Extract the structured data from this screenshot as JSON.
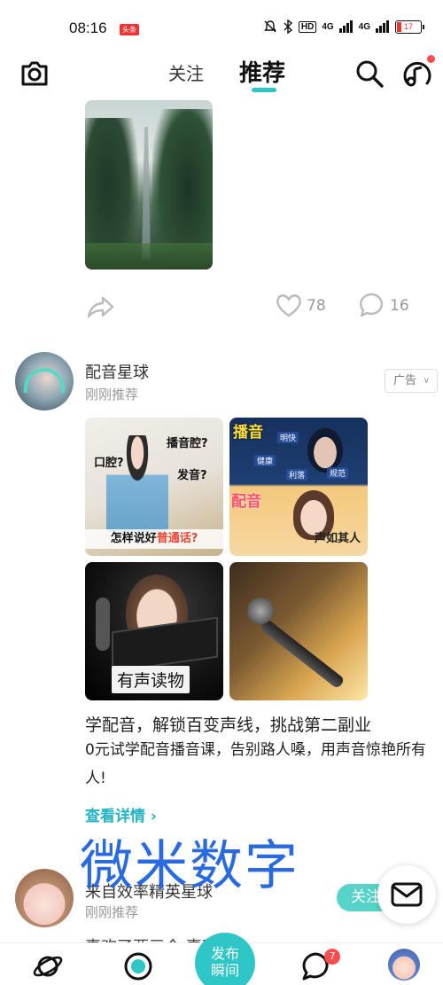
{
  "status_bar": {
    "time": "08:16",
    "app_badge": "头条",
    "hd": "HD",
    "signal_1": "4G",
    "signal_2": "4G",
    "battery": "17"
  },
  "top_nav": {
    "tab_follow": "关注",
    "tab_recommend": "推荐",
    "icons": [
      "camera-icon",
      "search-icon",
      "music-note-icon"
    ]
  },
  "post_1": {
    "likes": "78",
    "comments": "16"
  },
  "ad_post": {
    "author": "配音星球",
    "subtitle": "刚刚推荐",
    "ad_tag": "广告",
    "image_1": {
      "q1": "口腔?",
      "q2": "播音腔?",
      "q3": "发音?",
      "banner_pre": "怎样说好",
      "banner_hl": "普通话?"
    },
    "image_2": {
      "tag_top": "播音",
      "words": [
        "明快",
        "健康",
        "利落",
        "规范"
      ],
      "tag_bottom": "配音",
      "caption": "声如其人"
    },
    "image_3": {
      "label": "有声读物"
    },
    "title": "学配音，解锁百变声线，挑战第二副业",
    "description": "0元试学配音播音课，告别路人嗓，用声音惊艳所有人!",
    "detail_link": "查看详情 ›"
  },
  "watermark": "微米数字",
  "post_3": {
    "author": "来自效率精英星球",
    "subtitle": "刚刚推荐",
    "follow": "关注",
    "peek_text": "喜欢了两三个      喜萝"
  },
  "bottom_nav": {
    "publish": "发布\n瞬间",
    "msg_badge": "7"
  }
}
